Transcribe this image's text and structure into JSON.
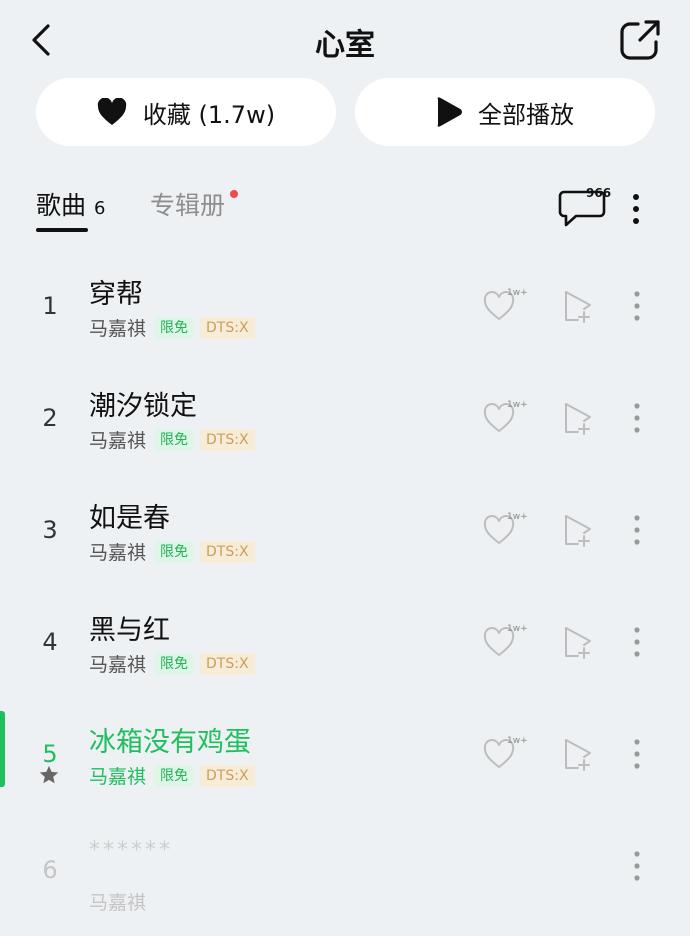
{
  "header": {
    "title": "心室"
  },
  "actions": {
    "favorite_label": "收藏 (1.7w)",
    "play_all_label": "全部播放"
  },
  "tabs": {
    "songs_label": "歌曲",
    "songs_count": "6",
    "albums_label": "专辑册"
  },
  "comments": {
    "count": "966"
  },
  "song_badge": "1w+",
  "songs": [
    {
      "num": "1",
      "name": "穿帮",
      "artist": "马嘉祺",
      "tag_free": "限免",
      "tag_dts": "DTS:X"
    },
    {
      "num": "2",
      "name": "潮汐锁定",
      "artist": "马嘉祺",
      "tag_free": "限免",
      "tag_dts": "DTS:X"
    },
    {
      "num": "3",
      "name": "如是春",
      "artist": "马嘉祺",
      "tag_free": "限免",
      "tag_dts": "DTS:X"
    },
    {
      "num": "4",
      "name": "黑与红",
      "artist": "马嘉祺",
      "tag_free": "限免",
      "tag_dts": "DTS:X"
    },
    {
      "num": "5",
      "name": "冰箱没有鸡蛋",
      "artist": "马嘉祺",
      "tag_free": "限免",
      "tag_dts": "DTS:X"
    },
    {
      "num": "6",
      "name": "******",
      "artist": "马嘉祺"
    }
  ],
  "colors": {
    "accent": "#1fbf5f",
    "background": "#eef1f3",
    "free_tag": "#22b35b",
    "dts_tag": "#caa05a",
    "dot": "#f04a4a"
  }
}
